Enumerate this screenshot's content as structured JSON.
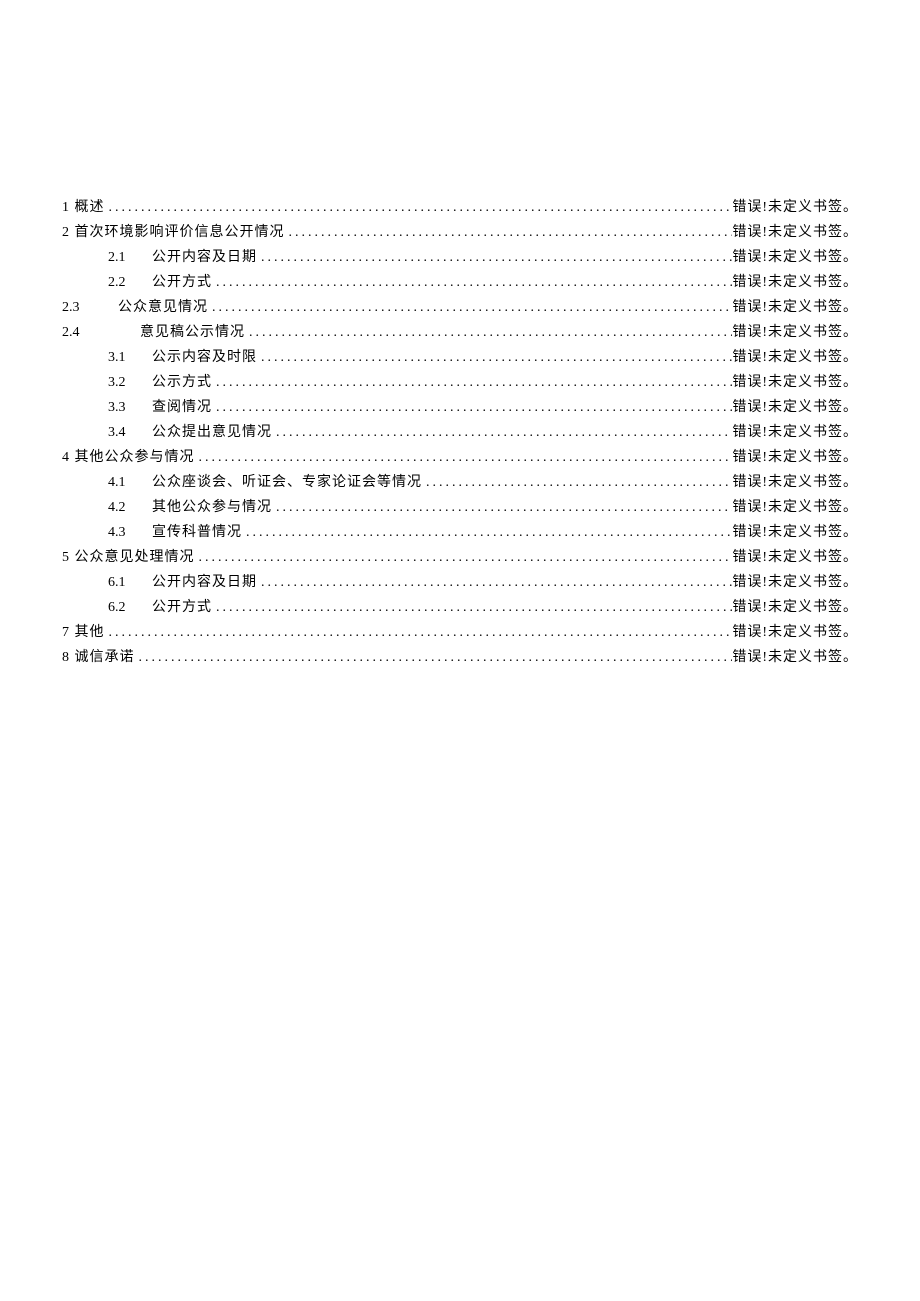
{
  "toc": {
    "error_text": "错误!未定义书签。",
    "entries": [
      {
        "level": "level-1",
        "prefix": "1 概述"
      },
      {
        "level": "level-1",
        "prefix": "2 首次环境影响评价信息公开情况"
      },
      {
        "level": "level-2",
        "num": "2.1",
        "title": "公开内容及日期"
      },
      {
        "level": "level-2",
        "num": "2.2",
        "title": "公开方式"
      },
      {
        "level": "level-2-alt",
        "num": "2.3",
        "title": "公众意见情况"
      },
      {
        "level": "level-2-alt-b",
        "num": "2.4",
        "title": "意见稿公示情况"
      },
      {
        "level": "level-2",
        "num": "3.1",
        "title": "公示内容及时限"
      },
      {
        "level": "level-2",
        "num": "3.2",
        "title": "公示方式"
      },
      {
        "level": "level-2",
        "num": "3.3",
        "title": "查阅情况"
      },
      {
        "level": "level-2",
        "num": "3.4",
        "title": "公众提出意见情况"
      },
      {
        "level": "level-1",
        "prefix": "4 其他公众参与情况"
      },
      {
        "level": "level-2",
        "num": "4.1",
        "title": "公众座谈会、听证会、专家论证会等情况"
      },
      {
        "level": "level-2",
        "num": "4.2",
        "title": "其他公众参与情况"
      },
      {
        "level": "level-2",
        "num": "4.3",
        "title": "宣传科普情况"
      },
      {
        "level": "level-1",
        "prefix": "5 公众意见处理情况"
      },
      {
        "level": "level-2",
        "num": "6.1",
        "title": "公开内容及日期"
      },
      {
        "level": "level-2",
        "num": "6.2",
        "title": "公开方式"
      },
      {
        "level": "level-1",
        "prefix": "7 其他"
      },
      {
        "level": "level-1",
        "prefix": "8 诚信承诺"
      }
    ]
  }
}
